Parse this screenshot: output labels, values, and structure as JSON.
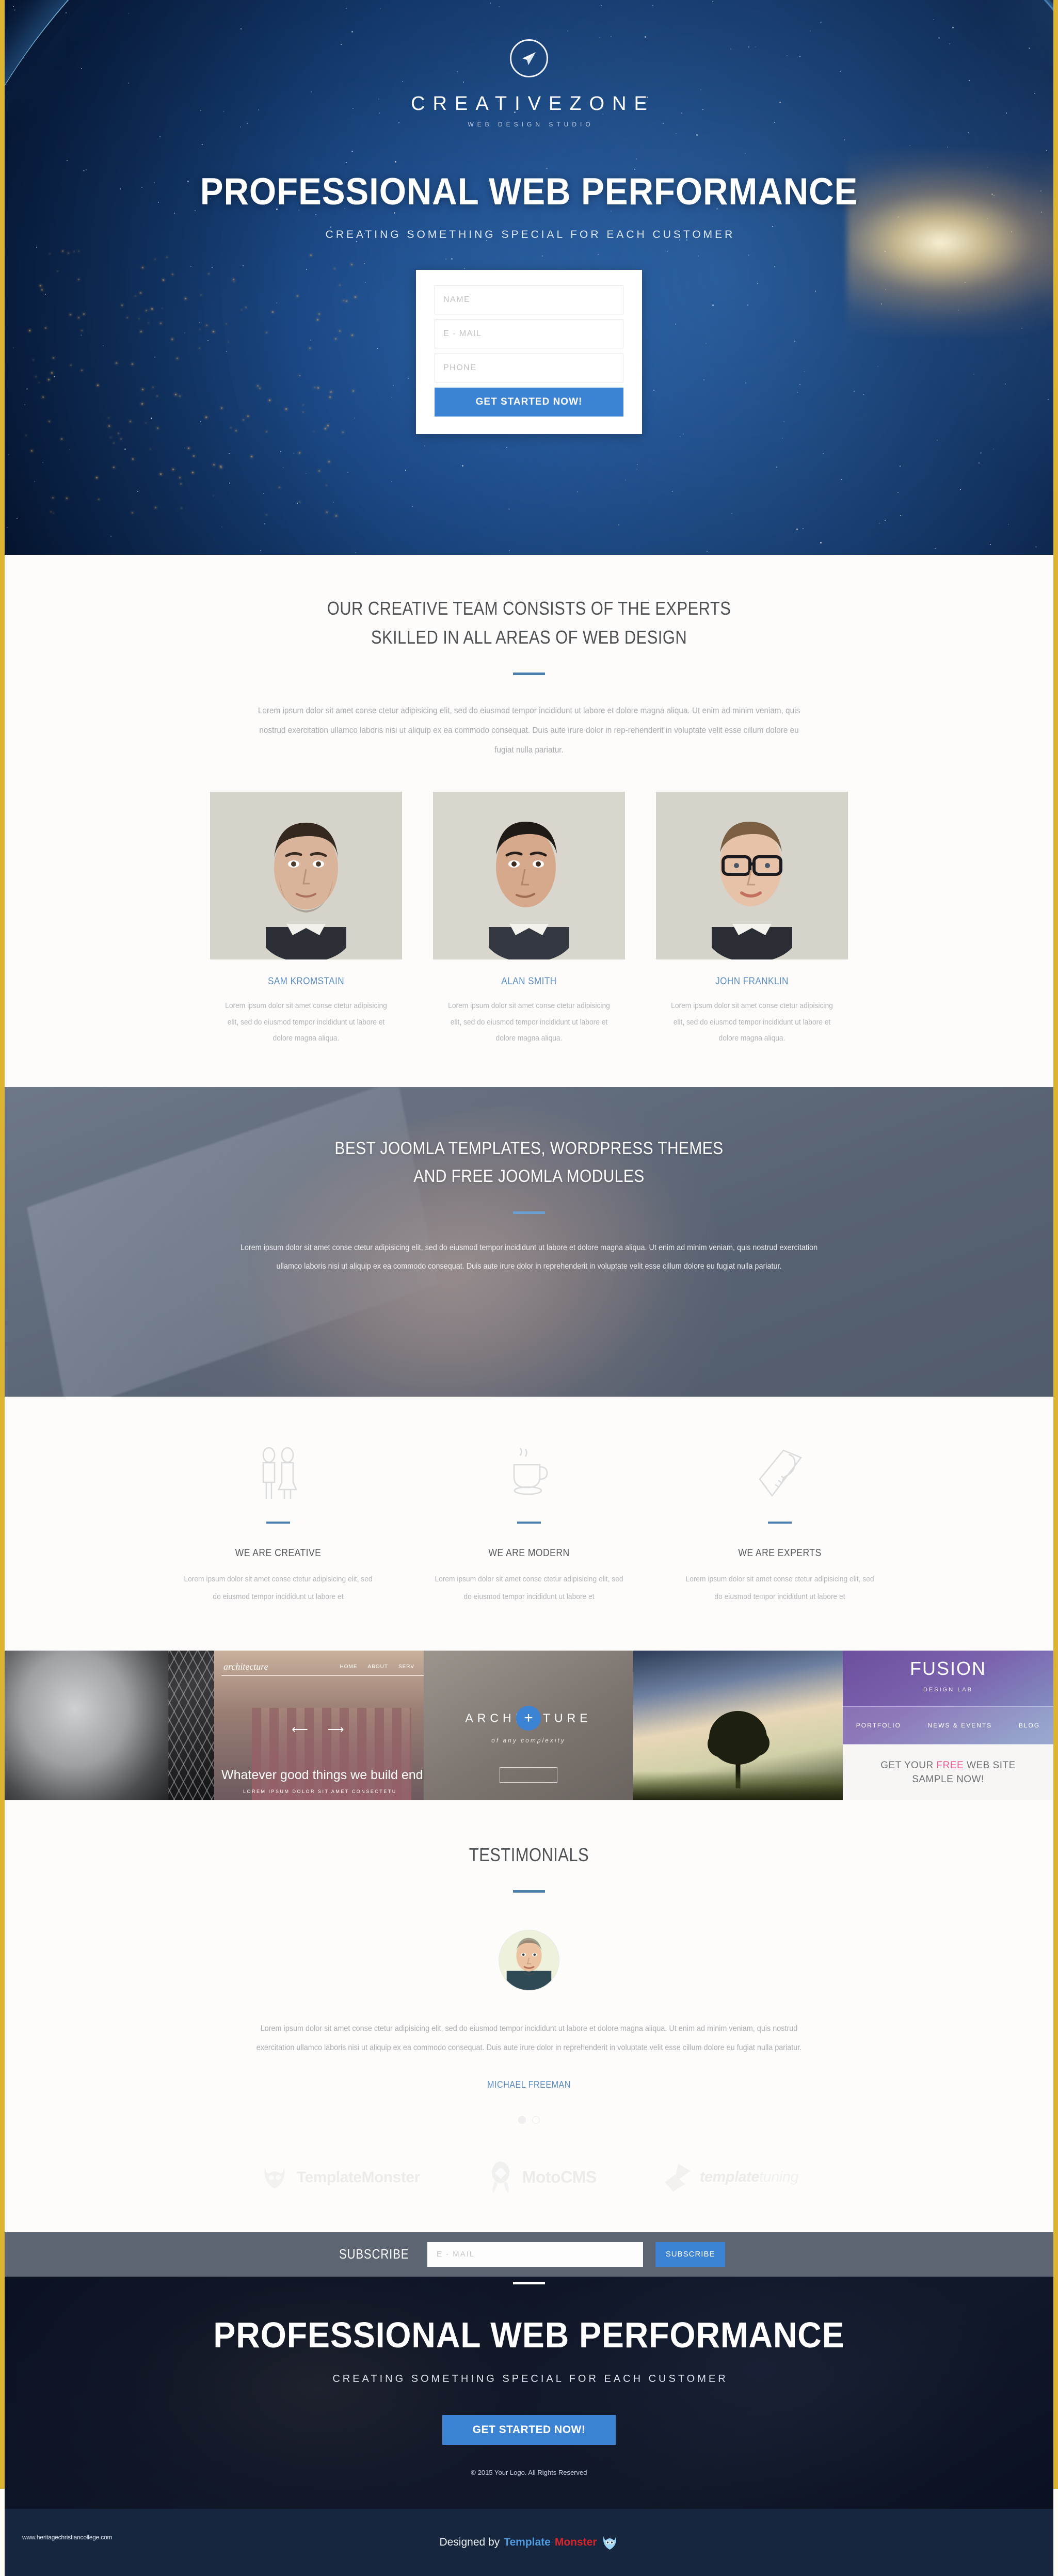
{
  "brand": {
    "logo_icon": "paper-plane-icon",
    "name": "CREATIVEZONE",
    "tagline": "WEB DESIGN STUDIO"
  },
  "hero": {
    "title": "PROFESSIONAL WEB PERFORMANCE",
    "subtitle": "CREATING SOMETHING SPECIAL FOR EACH CUSTOMER",
    "form": {
      "name_placeholder": "NAME",
      "email_placeholder": "E - MAIL",
      "phone_placeholder": "PHONE",
      "submit_label": "GET STARTED NOW!"
    }
  },
  "team": {
    "heading_line1": "OUR CREATIVE TEAM CONSISTS OF THE EXPERTS",
    "heading_line2": "SKILLED IN ALL AREAS OF WEB DESIGN",
    "lead": "Lorem ipsum dolor sit amet conse ctetur adipisicing elit, sed do eiusmod tempor incididunt ut labore et dolore magna aliqua. Ut enim ad minim veniam, quis nostrud exercitation ullamco laboris nisi ut aliquip ex ea commodo consequat. Duis aute irure dolor in rep-rehenderit in voluptate velit esse cillum dolore eu fugiat nulla pariatur.",
    "members": [
      {
        "name": "SAM KROMSTAIN",
        "desc": "Lorem ipsum dolor sit amet conse ctetur adipisicing elit, sed do eiusmod tempor incididunt ut labore et dolore magna aliqua."
      },
      {
        "name": "ALAN SMITH",
        "desc": "Lorem ipsum dolor sit amet conse ctetur adipisicing elit, sed do eiusmod tempor incididunt ut labore et dolore magna aliqua."
      },
      {
        "name": "JOHN FRANKLIN",
        "desc": "Lorem ipsum dolor sit amet conse ctetur adipisicing elit, sed do eiusmod tempor incididunt ut labore et dolore magna aliqua."
      }
    ]
  },
  "parallax": {
    "heading_line1": "BEST JOOMLA TEMPLATES, WORDPRESS THEMES",
    "heading_line2": "AND FREE JOOMLA MODULES",
    "lead": "Lorem ipsum dolor sit amet conse ctetur adipisicing elit, sed do eiusmod tempor incididunt ut labore et dolore magna aliqua. Ut enim ad minim veniam, quis nostrud exercitation ullamco laboris nisi ut aliquip ex ea commodo consequat. Duis aute irure dolor in reprehenderit in voluptate velit esse cillum dolore eu fugiat nulla pariatur."
  },
  "features": [
    {
      "icon": "two-people-icon",
      "title": "WE ARE CREATIVE",
      "desc": "Lorem ipsum dolor sit amet conse ctetur adipisicing elit, sed do eiusmod tempor incididunt ut labore et"
    },
    {
      "icon": "coffee-cup-icon",
      "title": "WE ARE MODERN",
      "desc": "Lorem ipsum dolor sit amet conse ctetur adipisicing elit, sed do eiusmod tempor incididunt ut labore et"
    },
    {
      "icon": "pencil-ruler-icon",
      "title": "WE ARE EXPERTS",
      "desc": "Lorem ipsum dolor sit amet conse ctetur adipisicing elit, sed do eiusmod tempor incididunt ut labore et"
    }
  ],
  "gallery": {
    "item2": {
      "logo": "architecture",
      "nav": [
        "HOME",
        "ABOUT",
        "SERV"
      ],
      "headline": "Whatever good things we build end u",
      "subline": "LOREM IPSUM DOLOR SIT AMET CONSECTETU"
    },
    "item3": {
      "title": "ARCHI      CTURE",
      "subtitle": "of any complexity",
      "plus_icon": "plus-icon"
    },
    "item5": {
      "logo": "FUSION",
      "tagline": "DESIGN LAB",
      "nav": [
        "PORTFOLIO",
        "NEWS & EVENTS",
        "BLOG"
      ],
      "cta_line1_a": "GET YOUR ",
      "cta_line1_b": "FREE",
      "cta_line1_c": " WEB SITE",
      "cta_line2": "SAMPLE NOW!"
    }
  },
  "testimonials": {
    "heading": "TESTIMONIALS",
    "quote": "Lorem ipsum dolor sit amet conse ctetur adipisicing elit, sed do eiusmod tempor incididunt ut labore et dolore magna aliqua. Ut enim ad minim veniam, quis nostrud exercitation ullamco laboris nisi ut aliquip ex ea commodo consequat. Duis aute irure dolor in reprehenderit in voluptate velit esse cillum dolore eu fugiat nulla pariatur.",
    "author": "MICHAEL FREEMAN",
    "slide_count": 2,
    "active_slide": 1
  },
  "partners": [
    {
      "name": "TemplateMonster",
      "icon": "monster-icon"
    },
    {
      "name": "MotoCMS",
      "icon": "rocket-icon"
    },
    {
      "name_bold": "template",
      "name_light": "tuning",
      "icon": "arrow-swirl-icon"
    }
  ],
  "subscribe": {
    "label": "SUBSCRIBE",
    "email_placeholder": "E - MAIL",
    "button_label": "SUBSCRIBE"
  },
  "footer": {
    "title": "PROFESSIONAL WEB PERFORMANCE",
    "subtitle": "CREATING SOMETHING SPECIAL FOR EACH CUSTOMER",
    "button_label": "GET STARTED NOW!",
    "copyright": "© 2015 Your Logo. All Rights Reserved"
  },
  "bottom": {
    "url": "www.heritagechristiancollege.com",
    "designed_by": "Designed by",
    "brand_part1": "Template",
    "brand_part2": "Monster",
    "mascot_icon": "monster-mascot-icon"
  },
  "colors": {
    "accent_blue": "#3d83d4",
    "rule_blue": "#4a7fb0",
    "name_blue": "#5b8ec4",
    "page_border": "#ddb431",
    "subscribe_bg": "#5d6573",
    "bottom_bar_bg": "#16263f"
  }
}
